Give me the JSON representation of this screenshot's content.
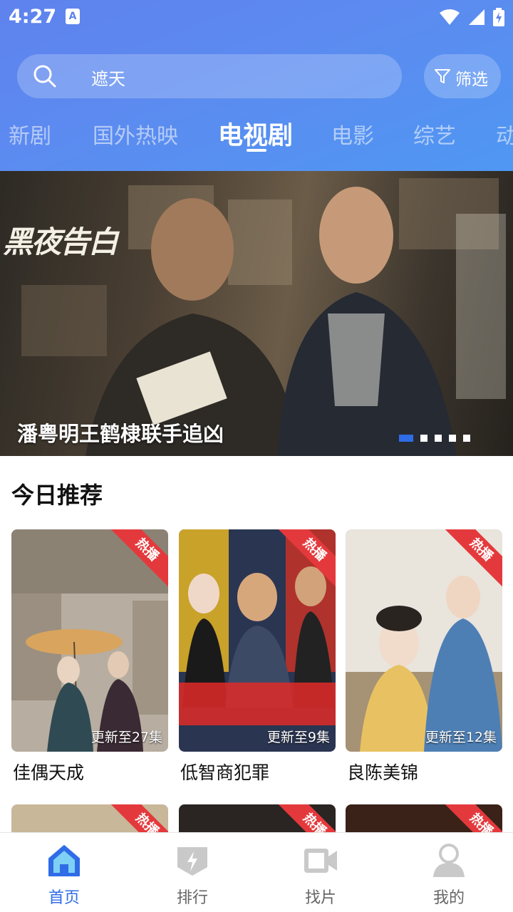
{
  "status_bar": {
    "time": "4:27",
    "notification_icon": "A"
  },
  "search": {
    "placeholder": "遮天"
  },
  "filter": {
    "label": "筛选"
  },
  "tabs": [
    {
      "label": "新剧"
    },
    {
      "label": "国外热映"
    },
    {
      "label": "电视剧",
      "active": true
    },
    {
      "label": "电影"
    },
    {
      "label": "综艺"
    },
    {
      "label": "动"
    }
  ],
  "banner": {
    "title_art": "黑夜告白",
    "caption": "潘粤明王鹤棣联手追凶",
    "slide_count": 5,
    "active_slide": 1
  },
  "section": {
    "title": "今日推荐"
  },
  "cards": [
    {
      "title": "佳偶天成",
      "badge": "热播",
      "update": "更新至27集"
    },
    {
      "title": "低智商犯罪",
      "badge": "热播",
      "update": "更新至9集"
    },
    {
      "title": "良陈美锦",
      "badge": "热播",
      "update": "更新至12集"
    }
  ],
  "cards_row2": [
    {
      "badge": "热播"
    },
    {
      "badge": "热播"
    },
    {
      "badge": "热播"
    }
  ],
  "bottom_nav": [
    {
      "label": "首页",
      "icon": "home-icon",
      "active": true
    },
    {
      "label": "排行",
      "icon": "ranking-icon"
    },
    {
      "label": "找片",
      "icon": "video-camera-icon"
    },
    {
      "label": "我的",
      "icon": "profile-icon"
    }
  ],
  "colors": {
    "accent": "#2f6ce6",
    "header_gradient_start": "#5f82ee",
    "hot_badge": "#e4393c"
  }
}
